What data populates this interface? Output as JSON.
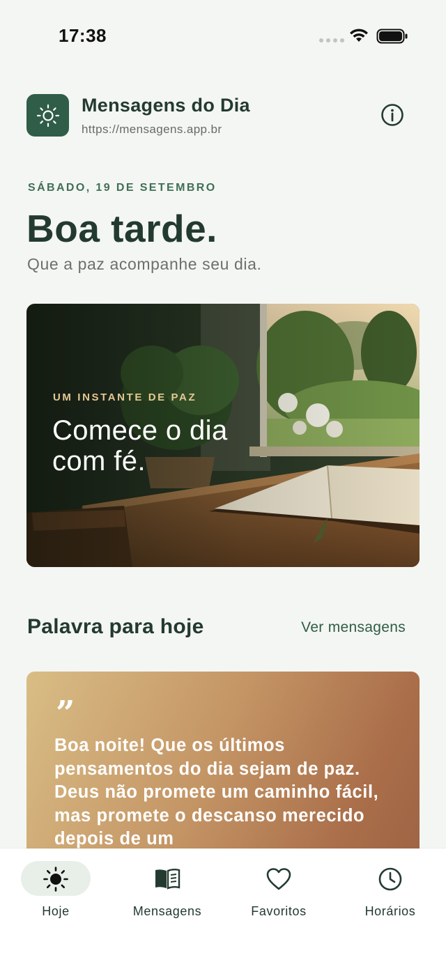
{
  "status": {
    "time": "17:38"
  },
  "app": {
    "title": "Mensagens do Dia",
    "url": "https://mensagens.app.br"
  },
  "today": {
    "date": "SÁBADO, 19 DE SETEMBRO",
    "greeting": "Boa tarde.",
    "subtitle": "Que a paz acompanhe seu dia."
  },
  "hero": {
    "eyebrow": "UM INSTANTE DE PAZ",
    "title": "Comece o dia com fé."
  },
  "section": {
    "title": "Palavra para hoje",
    "link": "Ver mensagens"
  },
  "quote": {
    "mark": "”",
    "text": "Boa noite! Que os últimos pensamentos do dia sejam de paz. Deus não promete um caminho fácil, mas promete o descanso merecido depois de um"
  },
  "tabs": [
    {
      "label": "Hoje",
      "icon": "sun-icon",
      "active": true
    },
    {
      "label": "Mensagens",
      "icon": "book-icon",
      "active": false
    },
    {
      "label": "Favoritos",
      "icon": "heart-icon",
      "active": false
    },
    {
      "label": "Horários",
      "icon": "clock-icon",
      "active": false
    }
  ],
  "colors": {
    "brand": "#2f5d48",
    "text": "#233a30",
    "accent_gold": "#e4c994",
    "background": "#f4f6f3"
  }
}
